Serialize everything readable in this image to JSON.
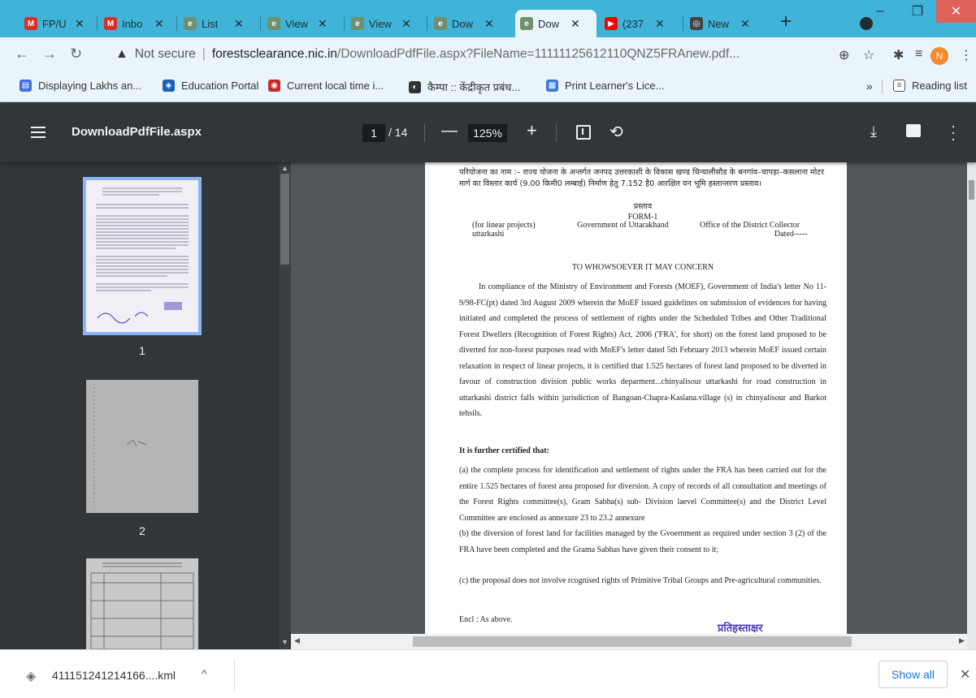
{
  "tabs": [
    {
      "title": "FP/U",
      "icon": "gmail-icon",
      "color": "#d93025",
      "glyph": "M"
    },
    {
      "title": "Inbo",
      "icon": "gmail-icon",
      "color": "#d93025",
      "glyph": "M"
    },
    {
      "title": "List",
      "icon": "site-icon",
      "color": "#6f8f6f",
      "glyph": "e"
    },
    {
      "title": "View",
      "icon": "site-icon",
      "color": "#6f8f6f",
      "glyph": "e"
    },
    {
      "title": "View",
      "icon": "site-icon",
      "color": "#6f8f6f",
      "glyph": "e"
    },
    {
      "title": "Dow",
      "icon": "site-icon",
      "color": "#6f8f6f",
      "glyph": "e"
    },
    {
      "title": "Dow",
      "icon": "site-icon",
      "color": "#6f8f6f",
      "glyph": "e",
      "active": true
    },
    {
      "title": "(237",
      "icon": "youtube-icon",
      "color": "#ff0000",
      "glyph": "▶"
    },
    {
      "title": "New",
      "icon": "openai-icon",
      "color": "#444444",
      "glyph": "◎"
    }
  ],
  "address": {
    "security": "Not secure",
    "host": "forestsclearance.nic.in",
    "path": "/DownloadPdfFile.aspx?FileName=11111125612110QNZ5FRAnew.pdf..."
  },
  "profile_initial": "N",
  "bookmarks": [
    {
      "label": "Displaying Lakhs an...",
      "color": "#3b6fd6",
      "glyph": "▤"
    },
    {
      "label": "Education Portal",
      "color": "#1a5fbf",
      "glyph": "◈"
    },
    {
      "label": "Current local time i...",
      "color": "#c62828",
      "glyph": "◉"
    },
    {
      "label": "कैम्पा :: केंद्रीकृत प्रबंध...",
      "color": "#333333",
      "glyph": "◐"
    },
    {
      "label": "Print Learner's Lice...",
      "color": "#3a7bd5",
      "glyph": "▦"
    }
  ],
  "bookmarks_more": "»",
  "reading_list": "Reading list",
  "pdf": {
    "title": "DownloadPdfFile.aspx",
    "page": "1",
    "total": "/ 14",
    "zoom": "125%"
  },
  "thumbnails": [
    {
      "label": "1"
    },
    {
      "label": "2"
    }
  ],
  "document": {
    "hindi_project": "परियोजना का नाम :– राज्य योजना के अन्तर्गत जनपद उत्तरकाशी के विकास खण्ड चिन्यालीसौड के बनगांव–चापड़ा–कसलाना मोटर मार्ग का विस्तार कार्य (9.00 किमी0 लम्बाई) निर्माण हेतु 7.152 है0 आरक्षित वन भूमि हस्तान्तरण प्रस्ताव।",
    "prastav": "प्रस्ताव",
    "form": "FORM-1",
    "col1": "(for linear projects)",
    "col1b": "uttarkashi",
    "col2": "Government of Uttarakhand",
    "col3": "Office of the District Collector",
    "col3b": "Dated-----",
    "heading": "TO WHOWSOEVER IT MAY CONCERN",
    "para1": "In compliance of the Ministry of Environment and Forests (MOEF), Government of India's letter No 11-9/98-FC(pt) dated 3rd August 2009 wherein the MoEF issued guidelines on submission of evidences for having initiated and completed the process of settlement of rights under the Scheduled Tribes and Other Traditional Forest Dwellers (Recognition of Forest Rights) Act, 2006 ('FRA', for short) on the forest land proposed to be diverted for non-forest purposes read with MoEF's letter dated 5th February 2013 wherein MoEF issued certain relaxation in respect of linear projects, it is certified that 1.525 hectares of forest land proposed to be diverted in favour of construction division public works deparment...chinyalisour uttarkashi for road construction in uttarkashi district falls within jurisdiction of Bangoan-Chapra-Kaslana.village (s) in chinyalisour and Barkot tehsils.",
    "further": "It is further certified that:",
    "para_a": "(a) the complete process for identification and settlement of rights under the FRA has been carried out for the entire 1.525 hectares of forest area proposed for diversion. A copy of records of all consultation and meetings of the Forest Rights committee(s), Gram Sabha(s) sub- Division laevel Committee(s) and the District Level Committee are enclosed as annexure 23 to 23.2 annexure",
    "para_b": "(b) the diversion of forest land for facilities managed by the Gvoernment as required under section 3 (2) of the FRA have been completed and the Grama Sabhas have given their consent to it;",
    "para_c": "(c) the proposal does not involve rcognised rights of Primitive Tribal Groups and Pre-agricultural communities.",
    "encl": "Encl : As above.",
    "stamp": "प्रतिहस्ताक्षर"
  },
  "download": {
    "filename": "411151241214166....kml",
    "show_all": "Show all"
  }
}
